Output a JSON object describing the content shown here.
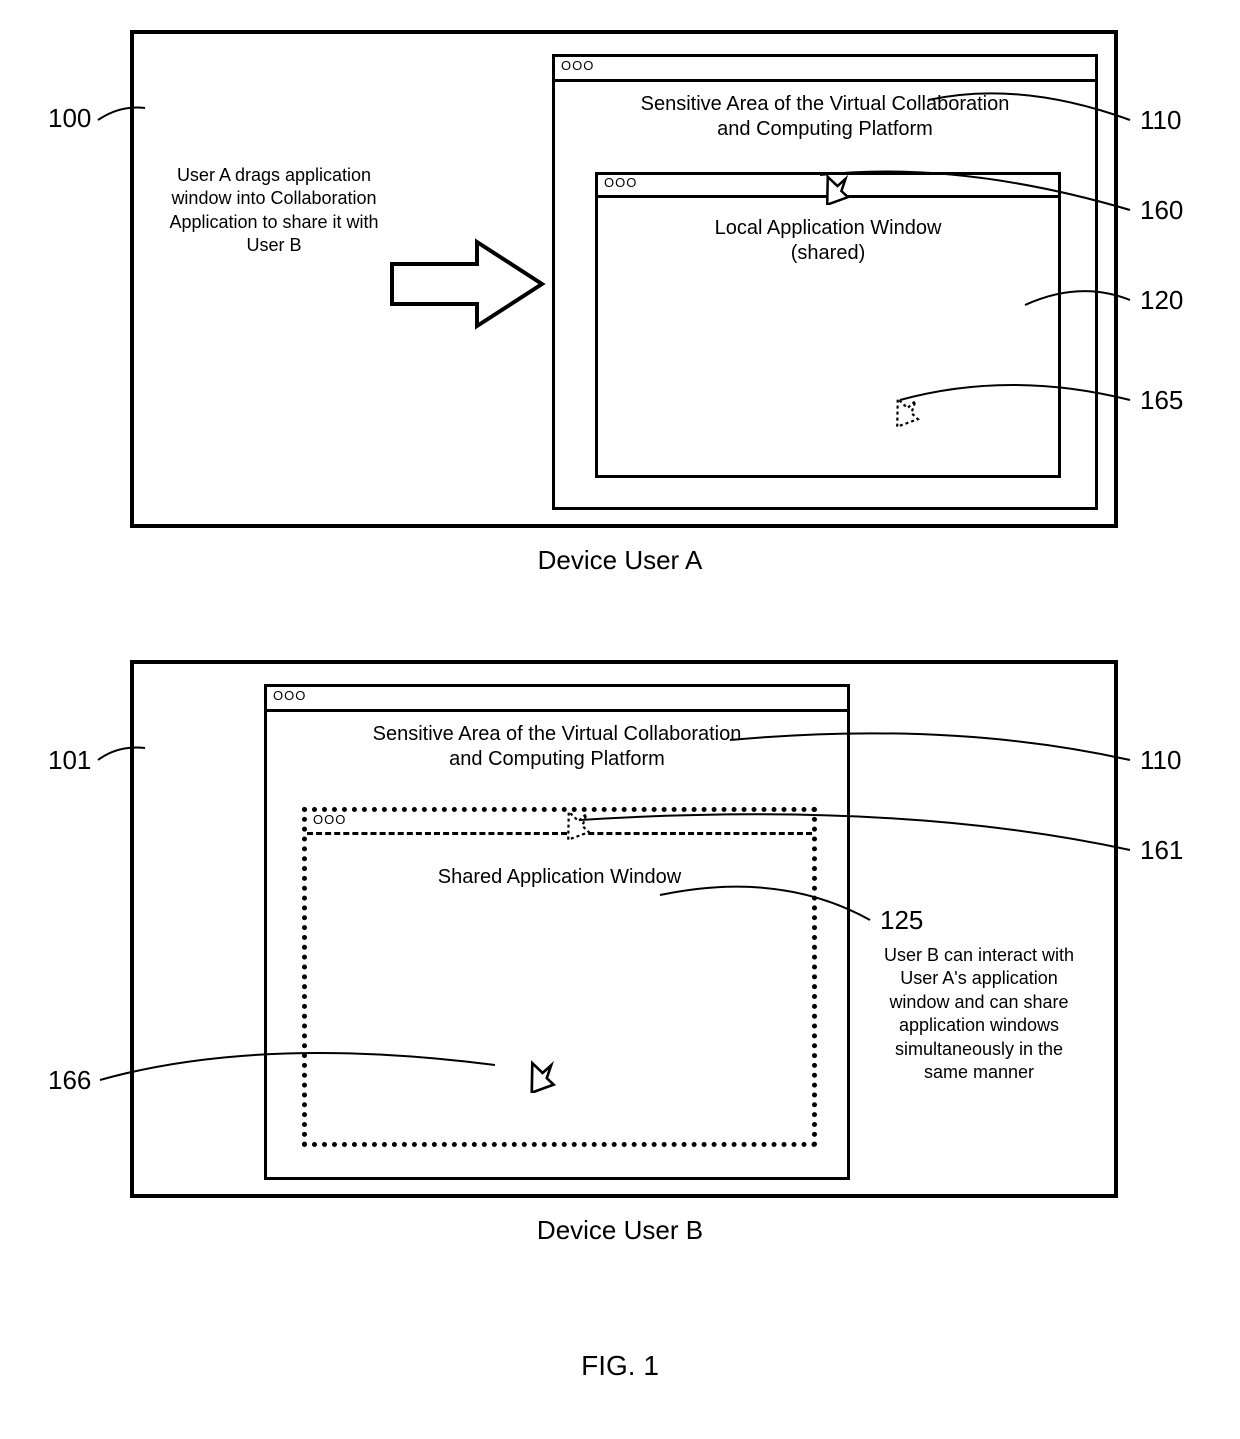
{
  "deviceA": {
    "caption": "Device User A",
    "platform": {
      "titlebar_dots": "OOO",
      "sensitive_line1": "Sensitive Area of the Virtual Collaboration",
      "sensitive_line2": "and Computing Platform",
      "inner": {
        "titlebar_dots": "OOO",
        "body_line1": "Local Application Window",
        "body_line2": "(shared)"
      }
    },
    "side_label": "User A drags application window into Collaboration Application to share it with User B"
  },
  "deviceB": {
    "caption": "Device User B",
    "platform": {
      "titlebar_dots": "OOO",
      "sensitive_line1": "Sensitive Area of the Virtual Collaboration",
      "sensitive_line2": "and Computing Platform",
      "inner": {
        "titlebar_dots": "OOO",
        "body_line1": "Shared Application Window"
      }
    },
    "side_label": "User B can interact with User A's application window and can share application windows simultaneously in the same manner"
  },
  "refs": {
    "r100": "100",
    "r101": "101",
    "r110a": "110",
    "r110b": "110",
    "r120": "120",
    "r125": "125",
    "r160": "160",
    "r161": "161",
    "r165": "165",
    "r166": "166"
  },
  "figure_label": "FIG. 1"
}
